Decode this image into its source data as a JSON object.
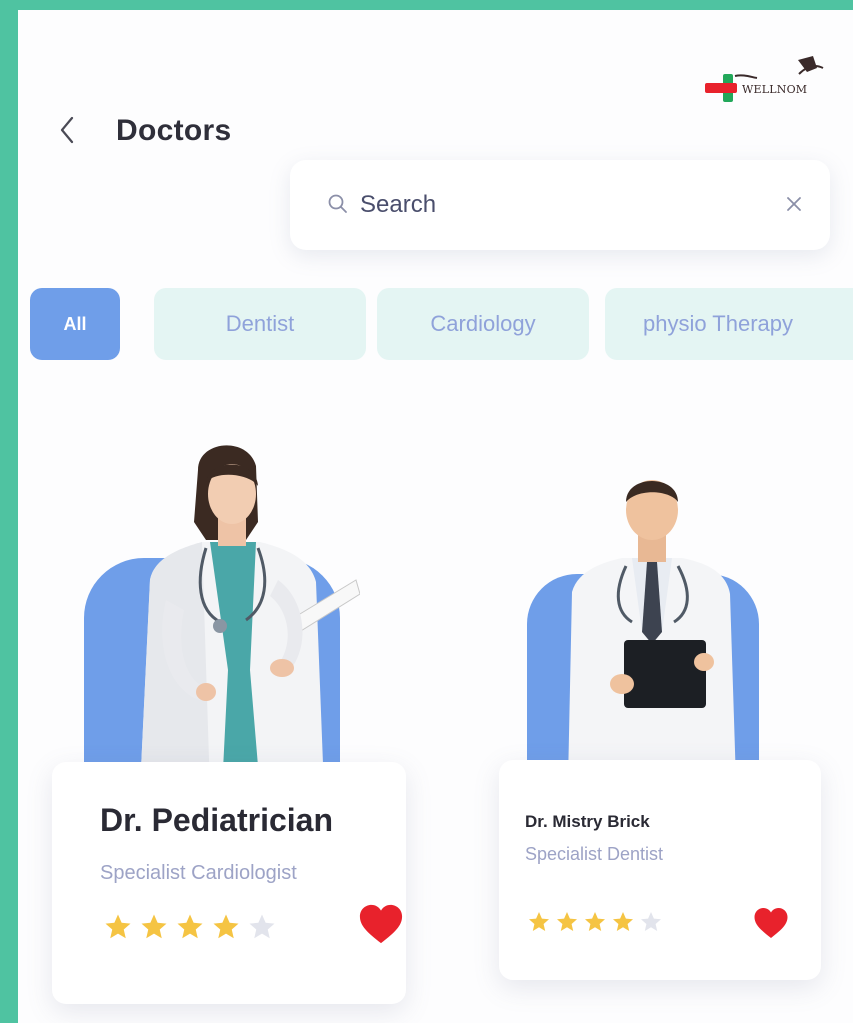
{
  "header": {
    "title": "Doctors",
    "logo_text": "WELLNOM"
  },
  "search": {
    "placeholder": "Search",
    "value": ""
  },
  "categories": [
    {
      "label": "All",
      "active": true
    },
    {
      "label": "Dentist",
      "active": false
    },
    {
      "label": "Cardiology",
      "active": false
    },
    {
      "label": "physio Therapy",
      "active": false
    }
  ],
  "doctors": [
    {
      "name": "Dr. Pediatrician",
      "specialty": "Specialist Cardiologist",
      "rating": 4,
      "max_rating": 5,
      "favorite": true
    },
    {
      "name": "Dr. Mistry Brick",
      "specialty": "Specialist Dentist",
      "rating": 4,
      "max_rating": 5,
      "favorite": true
    }
  ],
  "colors": {
    "frame": "#4fc3a1",
    "accent": "#6f9ee9",
    "chip_bg": "#e4f5f3",
    "star": "#f5c443",
    "star_empty": "#e2e4ec",
    "heart": "#e8222c"
  },
  "icons": {
    "back": "chevron-left-icon",
    "search": "search-icon",
    "clear": "close-icon",
    "favorite": "heart-icon",
    "rating": "star-icon"
  }
}
